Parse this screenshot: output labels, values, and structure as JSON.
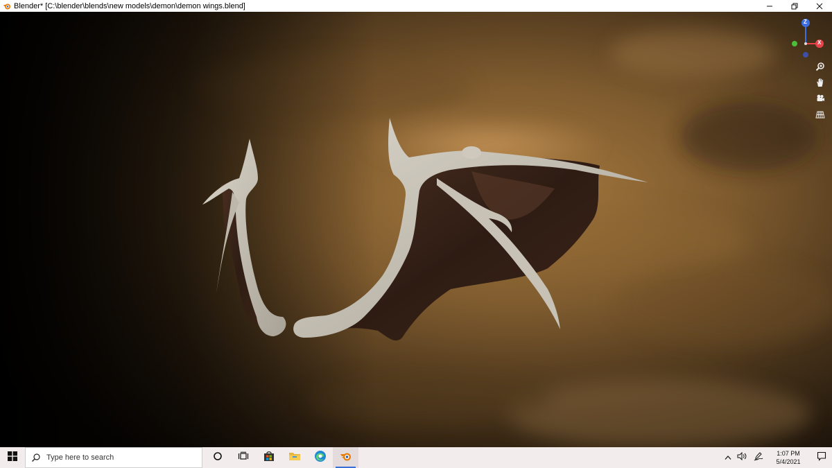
{
  "window": {
    "title": "Blender* [C:\\blender\\blends\\new models\\demon\\demon wings.blend]",
    "controls": {
      "minimize": "minimize-icon",
      "maximize": "restore-icon",
      "close": "close-icon"
    }
  },
  "viewport": {
    "gizmo": {
      "z_label": "Z",
      "x_label": "X",
      "colors": {
        "x": "#e8434a",
        "y": "#4bbf3a",
        "z": "#3d6fe0"
      }
    },
    "nav_tools": [
      "zoom-icon",
      "pan-hand-icon",
      "camera-icon",
      "grid-perspective-icon"
    ]
  },
  "taskbar": {
    "search_placeholder": "Type here to search",
    "apps": [
      "cortana-icon",
      "task-view-icon",
      "store-icon",
      "file-explorer-icon",
      "edge-icon",
      "blender-icon"
    ],
    "clock": {
      "time": "1:07 PM",
      "date": "5/4/2021"
    }
  }
}
